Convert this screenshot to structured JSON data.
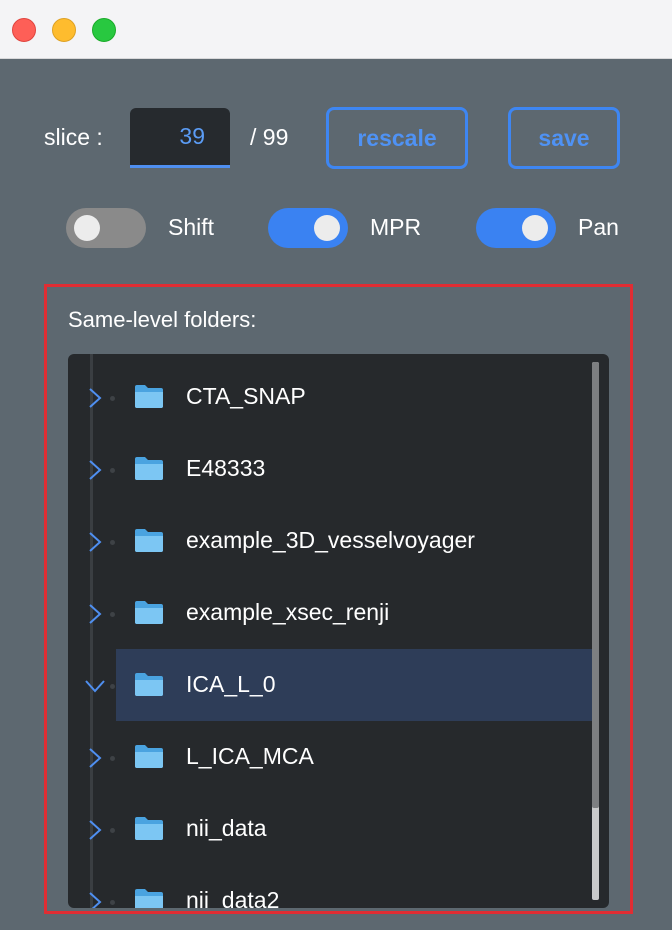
{
  "window": {
    "controls": [
      "close",
      "minimize",
      "maximize"
    ]
  },
  "toolbar": {
    "slice_label": "slice :",
    "slice_value": "39",
    "slice_total": "/ 99",
    "rescale_label": "rescale",
    "save_label": "save"
  },
  "toggles": [
    {
      "label": "Shift",
      "on": false
    },
    {
      "label": "MPR",
      "on": true
    },
    {
      "label": "Pan",
      "on": true
    }
  ],
  "folders": {
    "title": "Same-level folders:",
    "items": [
      {
        "name": "CTA_SNAP",
        "expanded": false,
        "selected": false,
        "icon": "folder-icon"
      },
      {
        "name": "E48333",
        "expanded": false,
        "selected": false,
        "icon": "folder-icon"
      },
      {
        "name": "example_3D_vesselvoyager",
        "expanded": false,
        "selected": false,
        "icon": "folder-icon"
      },
      {
        "name": "example_xsec_renji",
        "expanded": false,
        "selected": false,
        "icon": "folder-icon"
      },
      {
        "name": "ICA_L_0",
        "expanded": true,
        "selected": true,
        "icon": "folder-icon"
      },
      {
        "name": "L_ICA_MCA",
        "expanded": false,
        "selected": false,
        "icon": "folder-icon"
      },
      {
        "name": "nii_data",
        "expanded": false,
        "selected": false,
        "icon": "folder-icon"
      },
      {
        "name": "nii_data2",
        "expanded": false,
        "selected": false,
        "icon": "folder-icon"
      }
    ]
  },
  "colors": {
    "accent": "#3e86f2",
    "highlight_border": "#e02d33",
    "selected_row": "#2e3d58"
  }
}
